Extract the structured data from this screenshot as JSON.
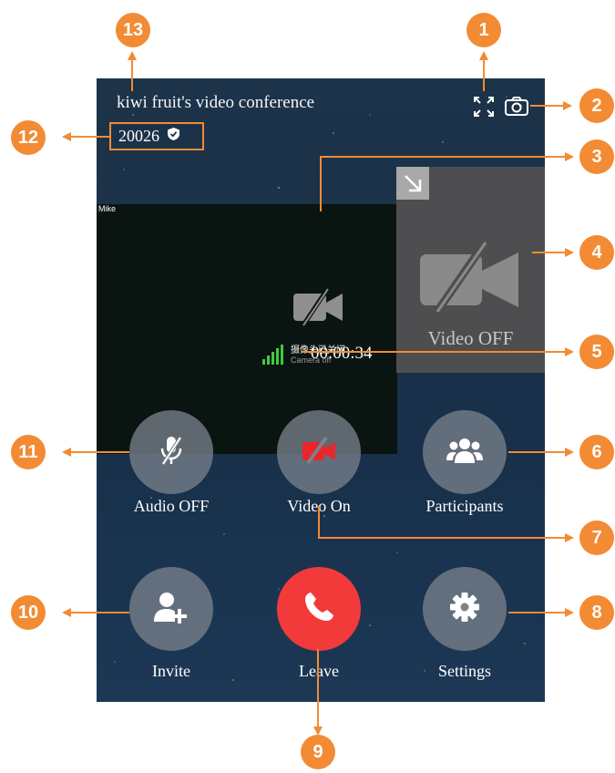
{
  "header": {
    "title": "kiwi fruit's video conference",
    "meeting_id": "20026"
  },
  "main_video": {
    "participant_name": "Mike",
    "camera_off_cn": "摄像头已关闭",
    "camera_off_en": "Camera off",
    "timer": "00:00:34"
  },
  "self_view": {
    "status": "Video OFF"
  },
  "controls": {
    "audio": "Audio OFF",
    "video": "Video On",
    "participants": "Participants",
    "invite": "Invite",
    "leave": "Leave",
    "settings": "Settings"
  },
  "annotations": [
    "1",
    "2",
    "3",
    "4",
    "5",
    "6",
    "7",
    "8",
    "9",
    "10",
    "11",
    "12",
    "13"
  ],
  "colors": {
    "annotation": "#f28b33",
    "leave": "#f23a3a",
    "video_off_icon": "#e8262c",
    "signal": "#3dcc3d"
  }
}
